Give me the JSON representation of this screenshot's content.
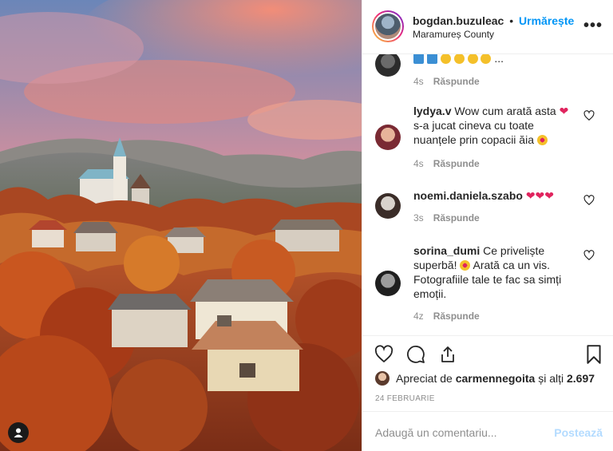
{
  "header": {
    "username": "bogdan.buzuleac",
    "separator": "•",
    "follow_label": "Urmărește",
    "location": "Maramureș County",
    "more": "•••"
  },
  "comments": [
    {
      "username": "",
      "text": "",
      "time": "4s",
      "reply": "Răspunde",
      "avatar_colors": [
        "#2c2c2c",
        "#6b6b6b"
      ]
    },
    {
      "username": "lydya.v",
      "text": "Wow cum arată asta",
      "text2": "s-a jucat cineva cu toate nuanțele prin copacii ăia",
      "time": "4s",
      "reply": "Răspunde",
      "avatar_colors": [
        "#e7b49a",
        "#7a2a33"
      ]
    },
    {
      "username": "noemi.daniela.szabo",
      "text": "",
      "time": "3s",
      "reply": "Răspunde",
      "avatar_colors": [
        "#d8d2cc",
        "#3a2c28"
      ]
    },
    {
      "username": "sorina_dumi",
      "text": "Ce priveliște superbă!",
      "text2": "Arată ca un vis. Fotografiile tale te fac sa simți emoții.",
      "time": "4z",
      "reply": "Răspunde",
      "avatar_colors": [
        "#9c9c9c",
        "#1f1f1f"
      ]
    }
  ],
  "actions": {
    "liked_by_prefix": "Apreciat de",
    "liked_by_user": "carmennegoita",
    "liked_by_suffix": "și alți",
    "likes_count": "2.697",
    "date": "24 FEBRUARIE"
  },
  "add_comment": {
    "placeholder": "Adaugă un comentariu...",
    "post_label": "Postează"
  },
  "colors": {
    "accent": "#0095f6",
    "post_disabled": "#b3dbff",
    "heart_red": "#ed4956"
  }
}
